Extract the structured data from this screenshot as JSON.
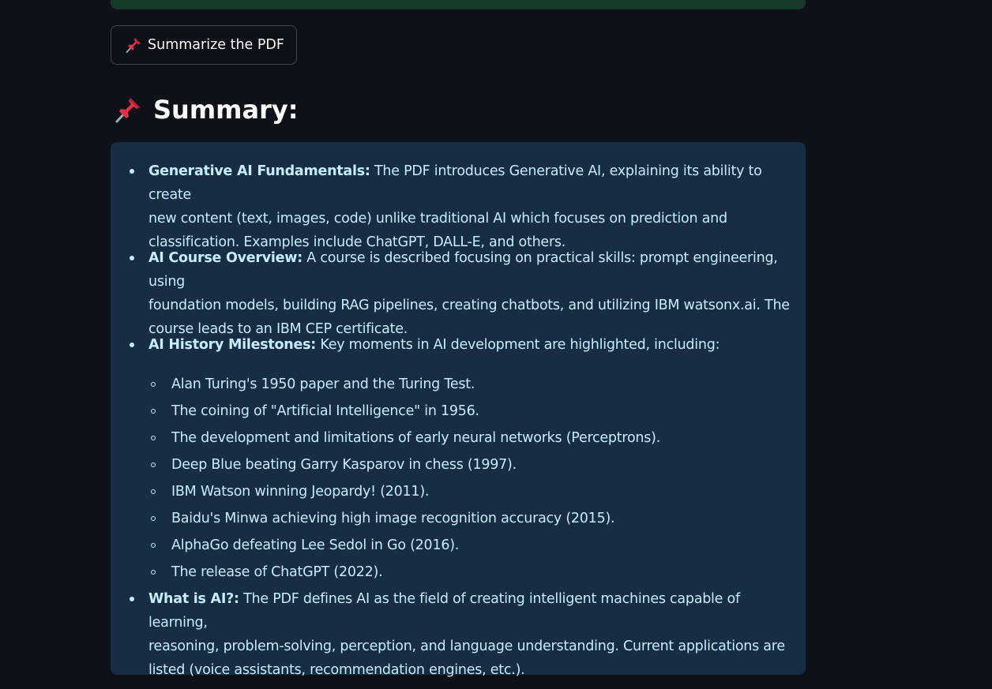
{
  "button": {
    "label": "Summarize the PDF",
    "icon": "pushpin-icon"
  },
  "heading": {
    "text": "Summary:",
    "icon": "pushpin-icon"
  },
  "colors": {
    "background": "#0e1117",
    "success_bar": "#173928",
    "info_box": "#172d43",
    "info_text": "#c7ebff",
    "pin_red": "#e0334a"
  },
  "summary": {
    "items": [
      {
        "title": "Generative AI Fundamentals:",
        "lines": [
          "The PDF introduces Generative AI, explaining its ability to create",
          "new content (text, images, code) unlike traditional AI which focuses on prediction and",
          "classification. Examples include ChatGPT, DALL-E, and others."
        ]
      },
      {
        "title": "AI Course Overview:",
        "lines": [
          "A course is described focusing on practical skills: prompt engineering, using",
          "foundation models, building RAG pipelines, creating chatbots, and utilizing IBM watsonx.ai. The",
          "course leads to an IBM CEP certificate."
        ]
      },
      {
        "title": "AI History Milestones:",
        "lines": [
          "Key moments in AI development are highlighted, including:"
        ],
        "subitems": [
          "Alan Turing's 1950 paper and the Turing Test.",
          "The coining of \"Artificial Intelligence\" in 1956.",
          "The development and limitations of early neural networks (Perceptrons).",
          "Deep Blue beating Garry Kasparov in chess (1997).",
          "IBM Watson winning Jeopardy! (2011).",
          "Baidu's Minwa achieving high image recognition accuracy (2015).",
          "AlphaGo defeating Lee Sedol in Go (2016).",
          "The release of ChatGPT (2022)."
        ]
      },
      {
        "title": "What is AI?:",
        "lines": [
          "The PDF defines AI as the field of creating intelligent machines capable of learning,",
          "reasoning, problem-solving, perception, and language understanding. Current applications are",
          "listed (voice assistants, recommendation engines, etc.)."
        ]
      }
    ]
  }
}
